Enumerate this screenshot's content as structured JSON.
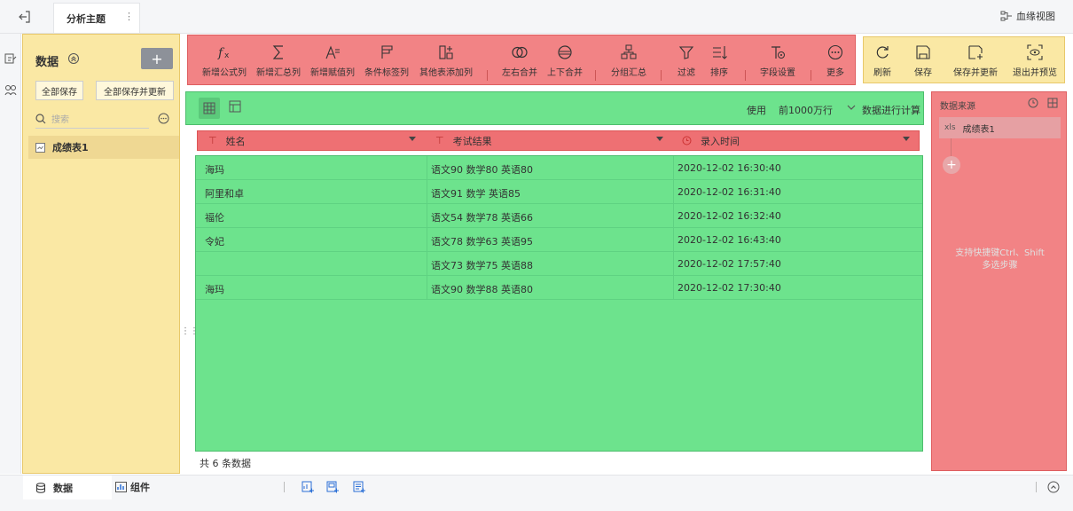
{
  "topbar": {
    "tab_title": "分析主题",
    "more": "⋮",
    "lineage_label": "血缘视图"
  },
  "data_panel": {
    "title": "数据",
    "add_label": "+",
    "save_all": "全部保存",
    "save_all_update": "全部保存并更新",
    "search_placeholder": "搜索",
    "table_item": "成绩表1"
  },
  "toolbar": {
    "tools": [
      {
        "label": "新增公式列",
        "icon": "fx-icon"
      },
      {
        "label": "新增汇总列",
        "icon": "sigma-icon"
      },
      {
        "label": "新增赋值列",
        "icon": "assign-icon"
      },
      {
        "label": "条件标签列",
        "icon": "flag-icon"
      },
      {
        "label": "其他表添加列",
        "icon": "add-column-icon"
      },
      {
        "label": "左右合并",
        "icon": "join-icon"
      },
      {
        "label": "上下合并",
        "icon": "union-icon"
      },
      {
        "label": "分组汇总",
        "icon": "group-icon"
      },
      {
        "label": "过滤",
        "icon": "filter-icon"
      },
      {
        "label": "排序",
        "icon": "sort-icon"
      },
      {
        "label": "字段设置",
        "icon": "field-settings-icon"
      },
      {
        "label": "更多",
        "icon": "more-icon"
      }
    ]
  },
  "toolbar2": {
    "tools": [
      {
        "label": "刷新",
        "icon": "refresh-icon"
      },
      {
        "label": "保存",
        "icon": "save-icon"
      },
      {
        "label": "保存并更新",
        "icon": "save-update-icon"
      },
      {
        "label": "退出并预览",
        "icon": "exit-preview-icon"
      }
    ]
  },
  "viewbar": {
    "use_label": "使用",
    "rows_option": "前1000万行",
    "calc_label": "数据进行计算"
  },
  "table": {
    "columns": [
      {
        "type_icon": "T",
        "name": "姓名"
      },
      {
        "type_icon": "T",
        "name": "考试结果"
      },
      {
        "type_icon": "clock",
        "name": "录入时间"
      }
    ],
    "rows": [
      [
        "海玛",
        "语文90 数学80 英语80",
        "2020-12-02 16:30:40"
      ],
      [
        "阿里和卓",
        "语文91 数学 英语85",
        "2020-12-02 16:31:40"
      ],
      [
        "福伦",
        "语文54 数学78 英语66",
        "2020-12-02 16:32:40"
      ],
      [
        "令妃",
        "语文78 数学63 英语95",
        "2020-12-02 16:43:40"
      ],
      [
        "",
        "语文73 数学75 英语88",
        "2020-12-02 17:57:40"
      ],
      [
        "海玛",
        "语文90 数学88 英语80",
        "2020-12-02 17:30:40"
      ]
    ],
    "footer": "共 6 条数据"
  },
  "datasource": {
    "title": "数据来源",
    "item_tag": "xls",
    "item": "成绩表1",
    "plus": "+",
    "hint_line1": "支持快捷键Ctrl、Shift",
    "hint_line2": "多选步骤"
  },
  "bottombar": {
    "tab_data": "数据",
    "tab_component": "组件"
  },
  "colors": {
    "red_zone": "#f28385",
    "yellow_zone": "#fae8a4",
    "green_zone": "#6de38d"
  }
}
